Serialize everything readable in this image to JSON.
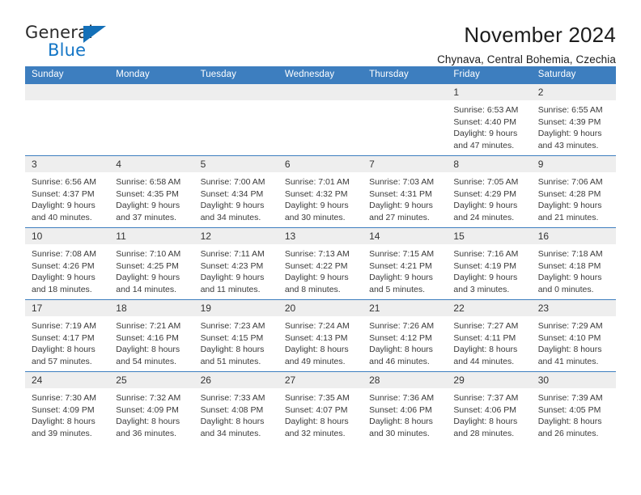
{
  "logo": {
    "word_one": "General",
    "word_two": "Blue",
    "triangle_color": "#1470b8",
    "blue_text_color": "#1476c6"
  },
  "header": {
    "title": "November 2024",
    "location": "Chynava, Central Bohemia, Czechia"
  },
  "theme": {
    "header_row_background": "#3d7ebf",
    "header_row_text": "#ffffff",
    "daynum_background": "#eeeeee",
    "row_divider": "#3d7ebf"
  },
  "weekday_headers": [
    "Sunday",
    "Monday",
    "Tuesday",
    "Wednesday",
    "Thursday",
    "Friday",
    "Saturday"
  ],
  "labels": {
    "sunrise_prefix": "Sunrise: ",
    "sunset_prefix": "Sunset: ",
    "daylight_prefix": "Daylight: "
  },
  "weeks": [
    [
      {
        "day": "",
        "empty": true
      },
      {
        "day": "",
        "empty": true
      },
      {
        "day": "",
        "empty": true
      },
      {
        "day": "",
        "empty": true
      },
      {
        "day": "",
        "empty": true
      },
      {
        "day": "1",
        "sunrise": "Sunrise: 6:53 AM",
        "sunset": "Sunset: 4:40 PM",
        "daylight_line1": "Daylight: 9 hours",
        "daylight_line2": "and 47 minutes."
      },
      {
        "day": "2",
        "sunrise": "Sunrise: 6:55 AM",
        "sunset": "Sunset: 4:39 PM",
        "daylight_line1": "Daylight: 9 hours",
        "daylight_line2": "and 43 minutes."
      }
    ],
    [
      {
        "day": "3",
        "sunrise": "Sunrise: 6:56 AM",
        "sunset": "Sunset: 4:37 PM",
        "daylight_line1": "Daylight: 9 hours",
        "daylight_line2": "and 40 minutes."
      },
      {
        "day": "4",
        "sunrise": "Sunrise: 6:58 AM",
        "sunset": "Sunset: 4:35 PM",
        "daylight_line1": "Daylight: 9 hours",
        "daylight_line2": "and 37 minutes."
      },
      {
        "day": "5",
        "sunrise": "Sunrise: 7:00 AM",
        "sunset": "Sunset: 4:34 PM",
        "daylight_line1": "Daylight: 9 hours",
        "daylight_line2": "and 34 minutes."
      },
      {
        "day": "6",
        "sunrise": "Sunrise: 7:01 AM",
        "sunset": "Sunset: 4:32 PM",
        "daylight_line1": "Daylight: 9 hours",
        "daylight_line2": "and 30 minutes."
      },
      {
        "day": "7",
        "sunrise": "Sunrise: 7:03 AM",
        "sunset": "Sunset: 4:31 PM",
        "daylight_line1": "Daylight: 9 hours",
        "daylight_line2": "and 27 minutes."
      },
      {
        "day": "8",
        "sunrise": "Sunrise: 7:05 AM",
        "sunset": "Sunset: 4:29 PM",
        "daylight_line1": "Daylight: 9 hours",
        "daylight_line2": "and 24 minutes."
      },
      {
        "day": "9",
        "sunrise": "Sunrise: 7:06 AM",
        "sunset": "Sunset: 4:28 PM",
        "daylight_line1": "Daylight: 9 hours",
        "daylight_line2": "and 21 minutes."
      }
    ],
    [
      {
        "day": "10",
        "sunrise": "Sunrise: 7:08 AM",
        "sunset": "Sunset: 4:26 PM",
        "daylight_line1": "Daylight: 9 hours",
        "daylight_line2": "and 18 minutes."
      },
      {
        "day": "11",
        "sunrise": "Sunrise: 7:10 AM",
        "sunset": "Sunset: 4:25 PM",
        "daylight_line1": "Daylight: 9 hours",
        "daylight_line2": "and 14 minutes."
      },
      {
        "day": "12",
        "sunrise": "Sunrise: 7:11 AM",
        "sunset": "Sunset: 4:23 PM",
        "daylight_line1": "Daylight: 9 hours",
        "daylight_line2": "and 11 minutes."
      },
      {
        "day": "13",
        "sunrise": "Sunrise: 7:13 AM",
        "sunset": "Sunset: 4:22 PM",
        "daylight_line1": "Daylight: 9 hours",
        "daylight_line2": "and 8 minutes."
      },
      {
        "day": "14",
        "sunrise": "Sunrise: 7:15 AM",
        "sunset": "Sunset: 4:21 PM",
        "daylight_line1": "Daylight: 9 hours",
        "daylight_line2": "and 5 minutes."
      },
      {
        "day": "15",
        "sunrise": "Sunrise: 7:16 AM",
        "sunset": "Sunset: 4:19 PM",
        "daylight_line1": "Daylight: 9 hours",
        "daylight_line2": "and 3 minutes."
      },
      {
        "day": "16",
        "sunrise": "Sunrise: 7:18 AM",
        "sunset": "Sunset: 4:18 PM",
        "daylight_line1": "Daylight: 9 hours",
        "daylight_line2": "and 0 minutes."
      }
    ],
    [
      {
        "day": "17",
        "sunrise": "Sunrise: 7:19 AM",
        "sunset": "Sunset: 4:17 PM",
        "daylight_line1": "Daylight: 8 hours",
        "daylight_line2": "and 57 minutes."
      },
      {
        "day": "18",
        "sunrise": "Sunrise: 7:21 AM",
        "sunset": "Sunset: 4:16 PM",
        "daylight_line1": "Daylight: 8 hours",
        "daylight_line2": "and 54 minutes."
      },
      {
        "day": "19",
        "sunrise": "Sunrise: 7:23 AM",
        "sunset": "Sunset: 4:15 PM",
        "daylight_line1": "Daylight: 8 hours",
        "daylight_line2": "and 51 minutes."
      },
      {
        "day": "20",
        "sunrise": "Sunrise: 7:24 AM",
        "sunset": "Sunset: 4:13 PM",
        "daylight_line1": "Daylight: 8 hours",
        "daylight_line2": "and 49 minutes."
      },
      {
        "day": "21",
        "sunrise": "Sunrise: 7:26 AM",
        "sunset": "Sunset: 4:12 PM",
        "daylight_line1": "Daylight: 8 hours",
        "daylight_line2": "and 46 minutes."
      },
      {
        "day": "22",
        "sunrise": "Sunrise: 7:27 AM",
        "sunset": "Sunset: 4:11 PM",
        "daylight_line1": "Daylight: 8 hours",
        "daylight_line2": "and 44 minutes."
      },
      {
        "day": "23",
        "sunrise": "Sunrise: 7:29 AM",
        "sunset": "Sunset: 4:10 PM",
        "daylight_line1": "Daylight: 8 hours",
        "daylight_line2": "and 41 minutes."
      }
    ],
    [
      {
        "day": "24",
        "sunrise": "Sunrise: 7:30 AM",
        "sunset": "Sunset: 4:09 PM",
        "daylight_line1": "Daylight: 8 hours",
        "daylight_line2": "and 39 minutes."
      },
      {
        "day": "25",
        "sunrise": "Sunrise: 7:32 AM",
        "sunset": "Sunset: 4:09 PM",
        "daylight_line1": "Daylight: 8 hours",
        "daylight_line2": "and 36 minutes."
      },
      {
        "day": "26",
        "sunrise": "Sunrise: 7:33 AM",
        "sunset": "Sunset: 4:08 PM",
        "daylight_line1": "Daylight: 8 hours",
        "daylight_line2": "and 34 minutes."
      },
      {
        "day": "27",
        "sunrise": "Sunrise: 7:35 AM",
        "sunset": "Sunset: 4:07 PM",
        "daylight_line1": "Daylight: 8 hours",
        "daylight_line2": "and 32 minutes."
      },
      {
        "day": "28",
        "sunrise": "Sunrise: 7:36 AM",
        "sunset": "Sunset: 4:06 PM",
        "daylight_line1": "Daylight: 8 hours",
        "daylight_line2": "and 30 minutes."
      },
      {
        "day": "29",
        "sunrise": "Sunrise: 7:37 AM",
        "sunset": "Sunset: 4:06 PM",
        "daylight_line1": "Daylight: 8 hours",
        "daylight_line2": "and 28 minutes."
      },
      {
        "day": "30",
        "sunrise": "Sunrise: 7:39 AM",
        "sunset": "Sunset: 4:05 PM",
        "daylight_line1": "Daylight: 8 hours",
        "daylight_line2": "and 26 minutes."
      }
    ]
  ]
}
